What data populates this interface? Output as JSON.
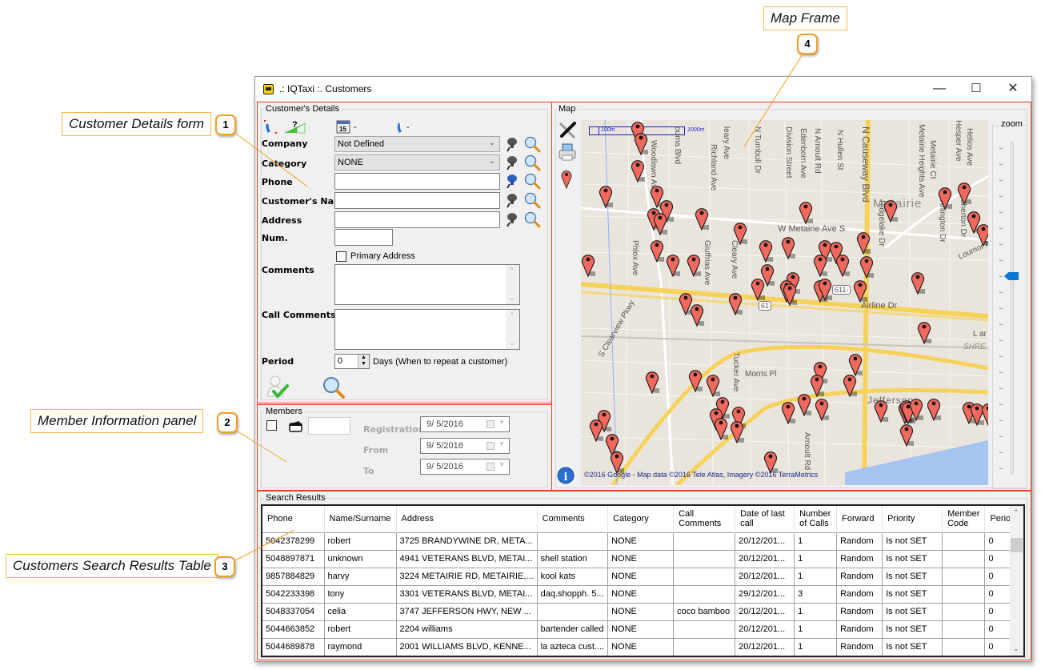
{
  "annotations": [
    {
      "num": "1",
      "label": "Customer Details form"
    },
    {
      "num": "2",
      "label": "Member Information panel"
    },
    {
      "num": "3",
      "label": "Customers Search Results Table"
    },
    {
      "num": "4",
      "label": "Map Frame"
    }
  ],
  "window": {
    "title": ".: IQTaxi :.  Customers",
    "minimize_glyph": "—",
    "maximize_glyph": "☐",
    "close_glyph": "✕"
  },
  "customer_details": {
    "group_title": "Customer's Details",
    "schedule_value": "-",
    "last_call_value": "-",
    "company_label": "Company",
    "company_value": "Not Defined",
    "category_label": "Category",
    "category_value": "NONE",
    "phone_label": "Phone",
    "phone_value": "",
    "name_label": "Customer's Nam",
    "name_value": "",
    "address_label": "Address",
    "address_value": "",
    "num_label": "Num.",
    "num_value": "",
    "primary_address_label": "Primary Address",
    "primary_address_checked": false,
    "comments_label": "Comments",
    "comments_value": "",
    "call_comments_label": "Call Comments",
    "call_comments_value": "",
    "period_label": "Period",
    "period_value": "0",
    "period_hint": "Days (When to repeat a customer)"
  },
  "members": {
    "group_title": "Members",
    "member_checked": false,
    "card_value": "",
    "registration_label": "Registration",
    "registration_value": "9/  5/2016",
    "from_label": "From",
    "from_value": "9/  5/2016",
    "to_label": "To",
    "to_value": "9/  5/2016"
  },
  "map": {
    "group_title": "Map",
    "scale_small": "100m",
    "scale_large": "1000m",
    "zoom_label": "zoom",
    "zoom_level_fraction": 0.4,
    "copyright": "©2016 Google - Map data ©2016 Tele Atlas, Imagery ©2016 TerraMetrics",
    "place_labels": [
      "Metairie",
      "Jefferson",
      "SHRE"
    ],
    "streets": [
      "Woodlawn Ave",
      "ouma Blvd",
      "Richland Ave",
      "leary Ave",
      "N Turnbull Dr",
      "Division Street",
      "Edenborn Ave",
      "N Arnoult Rd",
      "N Hullen St",
      "N Causeway Blvd",
      "Metairie Heights Ave",
      "Metairie Ct",
      "Hesper Ave",
      "Helios Ave",
      "W Metairie Ave S",
      "Ridgelake Dr",
      "Arlington Dr",
      "Atherton Dr",
      "Loumor Ave",
      "Phlox Ave",
      "Giuffrias Ave",
      "Cleary Ave",
      "S Clearview Pkwy",
      "Airline Dr",
      "Morris Pl",
      "Tucker Ave",
      "Arnoult Rd",
      "61",
      "611-",
      "L ar"
    ]
  },
  "search_results": {
    "group_title": "Search Results",
    "columns": [
      "Phone",
      "Name/Surname",
      "Address",
      "Comments",
      "Category",
      "Call Comments",
      "Date of last call",
      "Number of Calls",
      "Forward",
      "Priority",
      "Member Code",
      "Period"
    ],
    "rows": [
      [
        "5042378299",
        "robert",
        "3725 BRANDYWINE DR, META...",
        "",
        "NONE",
        "",
        "20/12/201...",
        "1",
        "Random",
        "Is not SET",
        "",
        "0"
      ],
      [
        "5048897871",
        "unknown",
        "4941 VETERANS BLVD, METAI...",
        "shell station",
        "NONE",
        "",
        "20/12/201...",
        "1",
        "Random",
        "Is not SET",
        "",
        "0"
      ],
      [
        "9857884829",
        "harvy",
        "3224 METAIRIE RD, METAIRIE,...",
        "kool kats",
        "NONE",
        "",
        "20/12/201...",
        "1",
        "Random",
        "Is not SET",
        "",
        "0"
      ],
      [
        "5042233398",
        "tony",
        "3301 VETERANS BLVD, METAI...",
        "daq.shopph. 5...",
        "NONE",
        "",
        "29/12/201...",
        "3",
        "Random",
        "Is not SET",
        "",
        "0"
      ],
      [
        "5048337054",
        "celia",
        "3747 JEFFERSON HWY, NEW ...",
        "",
        "NONE",
        "coco bamboo",
        "20/12/201...",
        "1",
        "Random",
        "Is not SET",
        "",
        "0"
      ],
      [
        " 5044663852",
        "robert",
        "2204 williams",
        "bartender called",
        "NONE",
        "",
        "20/12/201...",
        "1",
        "Random",
        "Is not SET",
        "",
        "0"
      ],
      [
        "5044689878",
        "raymond",
        "2001 WILLIAMS BLVD, KENNE...",
        "la azteca cust....",
        "NONE",
        "",
        "20/12/201...",
        "1",
        "Random",
        "Is not SET",
        "",
        "0"
      ]
    ]
  },
  "colors": {
    "frame_border": "#e8431c",
    "callout_border": "#f5b94a",
    "pin": "#f2685c",
    "zoom_thumb": "#0a78d7",
    "road_major": "#f6d25a"
  }
}
